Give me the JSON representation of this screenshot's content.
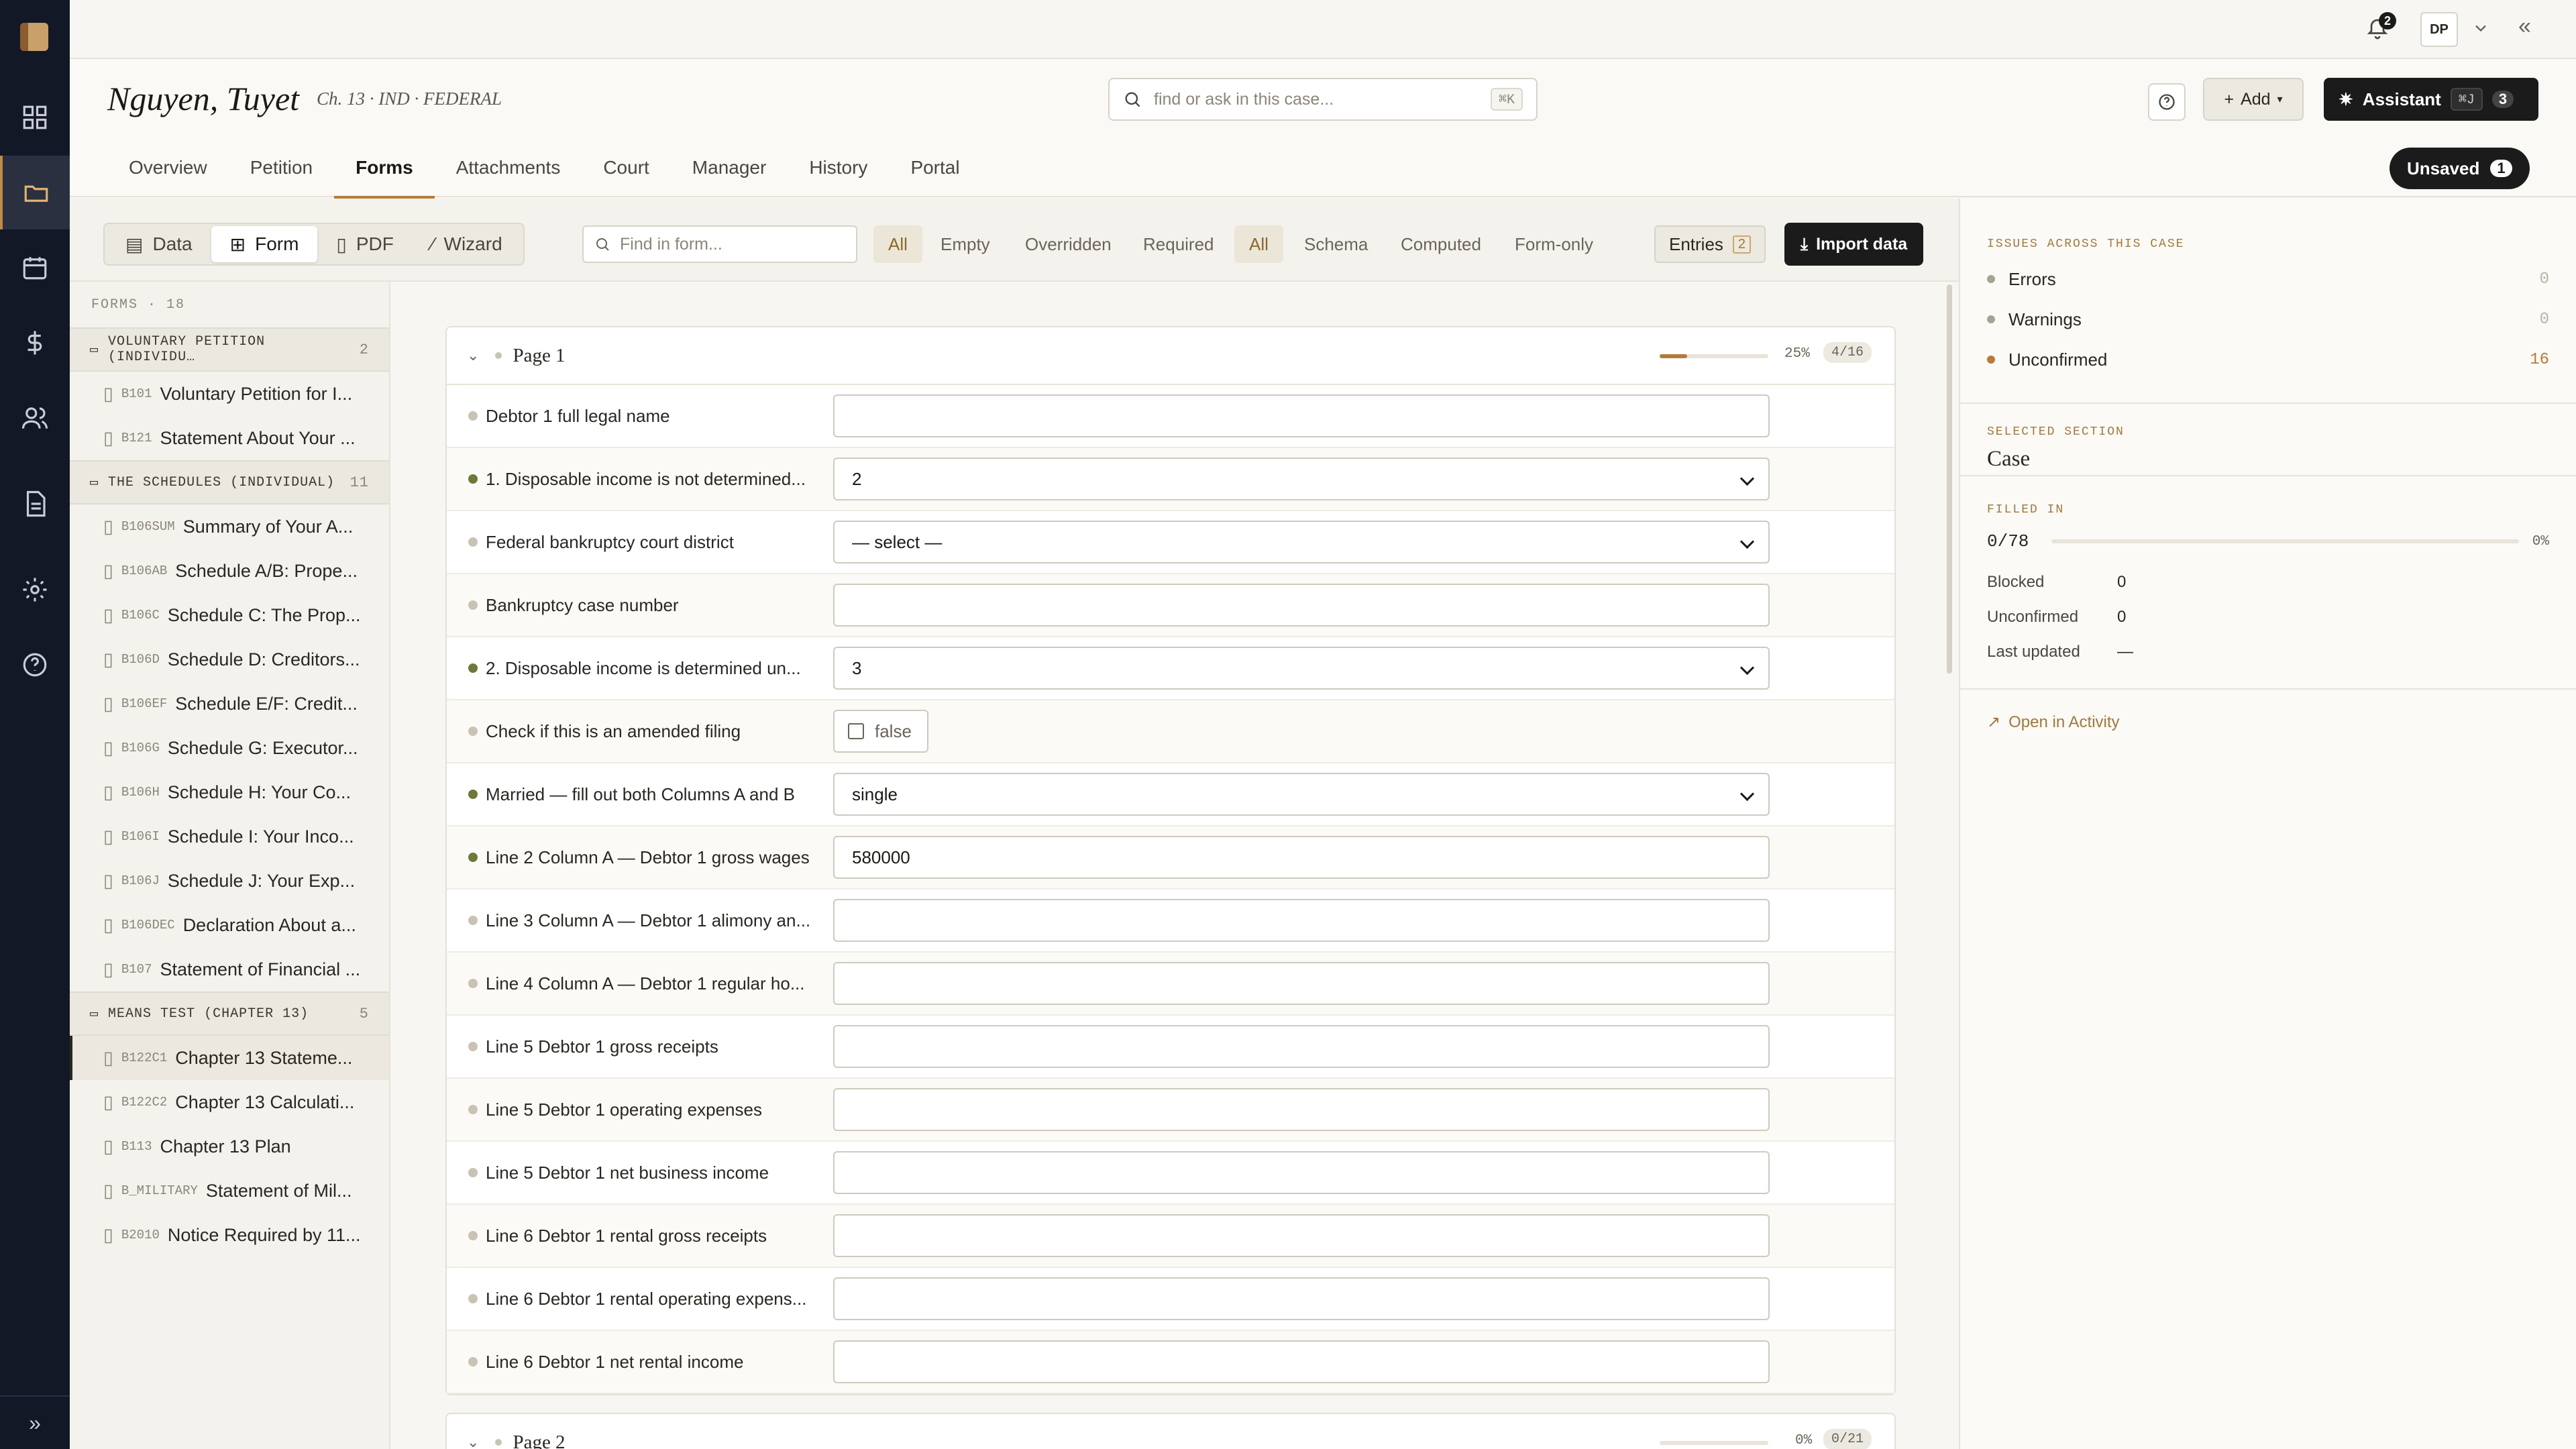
{
  "rail": {
    "items": [
      "dashboard-icon",
      "folder-icon",
      "calendar-icon",
      "dollar-icon",
      "users-icon",
      "document-icon",
      "gear-icon",
      "help-icon"
    ],
    "expand": "»"
  },
  "topbar": {
    "notif_count": "2",
    "user_initials": "DP",
    "collapse": "«"
  },
  "case": {
    "name": "Nguyen, Tuyet",
    "meta": "Ch. 13 · IND · FEDERAL",
    "search_placeholder": "find or ask in this case...",
    "search_kbd": "⌘K",
    "add_label": "Add",
    "assistant_label": "Assistant",
    "assistant_kbd": "⌘J",
    "assistant_count": "3",
    "unsaved_label": "Unsaved",
    "unsaved_count": "1",
    "tabs": [
      "Overview",
      "Petition",
      "Forms",
      "Attachments",
      "Court",
      "Manager",
      "History",
      "Portal"
    ]
  },
  "toolbar": {
    "views": [
      "Data",
      "Form",
      "PDF",
      "Wizard"
    ],
    "find_placeholder": "Find in form...",
    "filters1": [
      "All",
      "Empty",
      "Overridden",
      "Required"
    ],
    "filters2": [
      "All",
      "Schema",
      "Computed",
      "Form-only"
    ],
    "entries_label": "Entries",
    "entries_count": "2",
    "import_label": "Import data"
  },
  "forms": {
    "header": "FORMS · 18",
    "groups": [
      {
        "title": "VOLUNTARY PETITION (INDIVIDU…",
        "count": "2",
        "items": [
          {
            "code": "B101",
            "label": "Voluntary Petition for I..."
          },
          {
            "code": "B121",
            "label": "Statement About Your ..."
          }
        ]
      },
      {
        "title": "THE SCHEDULES (INDIVIDUAL)",
        "count": "11",
        "items": [
          {
            "code": "B106SUM",
            "label": "Summary of Your A..."
          },
          {
            "code": "B106AB",
            "label": "Schedule A/B: Prope..."
          },
          {
            "code": "B106C",
            "label": "Schedule C: The Prop..."
          },
          {
            "code": "B106D",
            "label": "Schedule D: Creditors..."
          },
          {
            "code": "B106EF",
            "label": "Schedule E/F: Credit..."
          },
          {
            "code": "B106G",
            "label": "Schedule G: Executor..."
          },
          {
            "code": "B106H",
            "label": "Schedule H: Your Co..."
          },
          {
            "code": "B106I",
            "label": "Schedule I: Your Inco..."
          },
          {
            "code": "B106J",
            "label": "Schedule J: Your Exp..."
          },
          {
            "code": "B106DEC",
            "label": "Declaration About a..."
          },
          {
            "code": "B107",
            "label": "Statement of Financial ..."
          }
        ]
      },
      {
        "title": "MEANS TEST (CHAPTER 13)",
        "count": "5",
        "items": [
          {
            "code": "B122C1",
            "label": "Chapter 13 Stateme..."
          },
          {
            "code": "B122C2",
            "label": "Chapter 13 Calculati..."
          },
          {
            "code": "B113",
            "label": "Chapter 13 Plan"
          },
          {
            "code": "B_MILITARY",
            "label": "Statement of Mil..."
          },
          {
            "code": "B2010",
            "label": "Notice Required by 11..."
          }
        ]
      }
    ]
  },
  "page1": {
    "title": "Page 1",
    "progress": 0.25,
    "progress_label": "25%",
    "count": "4/16",
    "fields": [
      {
        "label": "Debtor 1 full legal name",
        "type": "text",
        "value": "",
        "status": "empty"
      },
      {
        "label": "1. Disposable income is not determined...",
        "type": "select",
        "value": "2",
        "status": "filled"
      },
      {
        "label": "Federal bankruptcy court district",
        "type": "select",
        "value": "— select —",
        "status": "empty"
      },
      {
        "label": "Bankruptcy case number",
        "type": "text",
        "value": "",
        "status": "empty"
      },
      {
        "label": "2. Disposable income is determined un...",
        "type": "select",
        "value": "3",
        "status": "filled"
      },
      {
        "label": "Check if this is an amended filing",
        "type": "checkbox",
        "value": "false",
        "status": "empty"
      },
      {
        "label": "Married — fill out both Columns A and B",
        "type": "select",
        "value": "single",
        "status": "filled"
      },
      {
        "label": "Line 2 Column A — Debtor 1 gross wages",
        "type": "text",
        "value": "580000",
        "status": "filled"
      },
      {
        "label": "Line 3 Column A — Debtor 1 alimony an...",
        "type": "text",
        "value": "",
        "status": "empty"
      },
      {
        "label": "Line 4 Column A — Debtor 1 regular ho...",
        "type": "text",
        "value": "",
        "status": "empty"
      },
      {
        "label": "Line 5 Debtor 1 gross receipts",
        "type": "text",
        "value": "",
        "status": "empty"
      },
      {
        "label": "Line 5 Debtor 1 operating expenses",
        "type": "text",
        "value": "",
        "status": "empty"
      },
      {
        "label": "Line 5 Debtor 1 net business income",
        "type": "text",
        "value": "",
        "status": "empty"
      },
      {
        "label": "Line 6 Debtor 1 rental gross receipts",
        "type": "text",
        "value": "",
        "status": "empty"
      },
      {
        "label": "Line 6 Debtor 1 rental operating expens...",
        "type": "text",
        "value": "",
        "status": "empty"
      },
      {
        "label": "Line 6 Debtor 1 net rental income",
        "type": "text",
        "value": "",
        "status": "empty"
      }
    ]
  },
  "page2": {
    "title": "Page 2",
    "progress": 0,
    "progress_label": "0%",
    "count": "0/21"
  },
  "side": {
    "issues_caption": "ISSUES ACROSS THIS CASE",
    "issues": [
      {
        "label": "Errors",
        "value": "0"
      },
      {
        "label": "Warnings",
        "value": "0"
      },
      {
        "label": "Unconfirmed",
        "value": "16"
      }
    ],
    "section_caption": "SELECTED SECTION",
    "section_value": "Case",
    "filled_caption": "FILLED IN",
    "filled_value": "0/78",
    "filled_pct": "0%",
    "stats": [
      {
        "k": "Blocked",
        "v": "0"
      },
      {
        "k": "Unconfirmed",
        "v": "0"
      },
      {
        "k": "Last updated",
        "v": "—"
      }
    ],
    "activity_link": "Open in Activity"
  },
  "colors": {
    "accent": "#b77a3a",
    "dark": "#1b1b1b",
    "rail": "#121826",
    "filled": "#6b7a3a"
  }
}
